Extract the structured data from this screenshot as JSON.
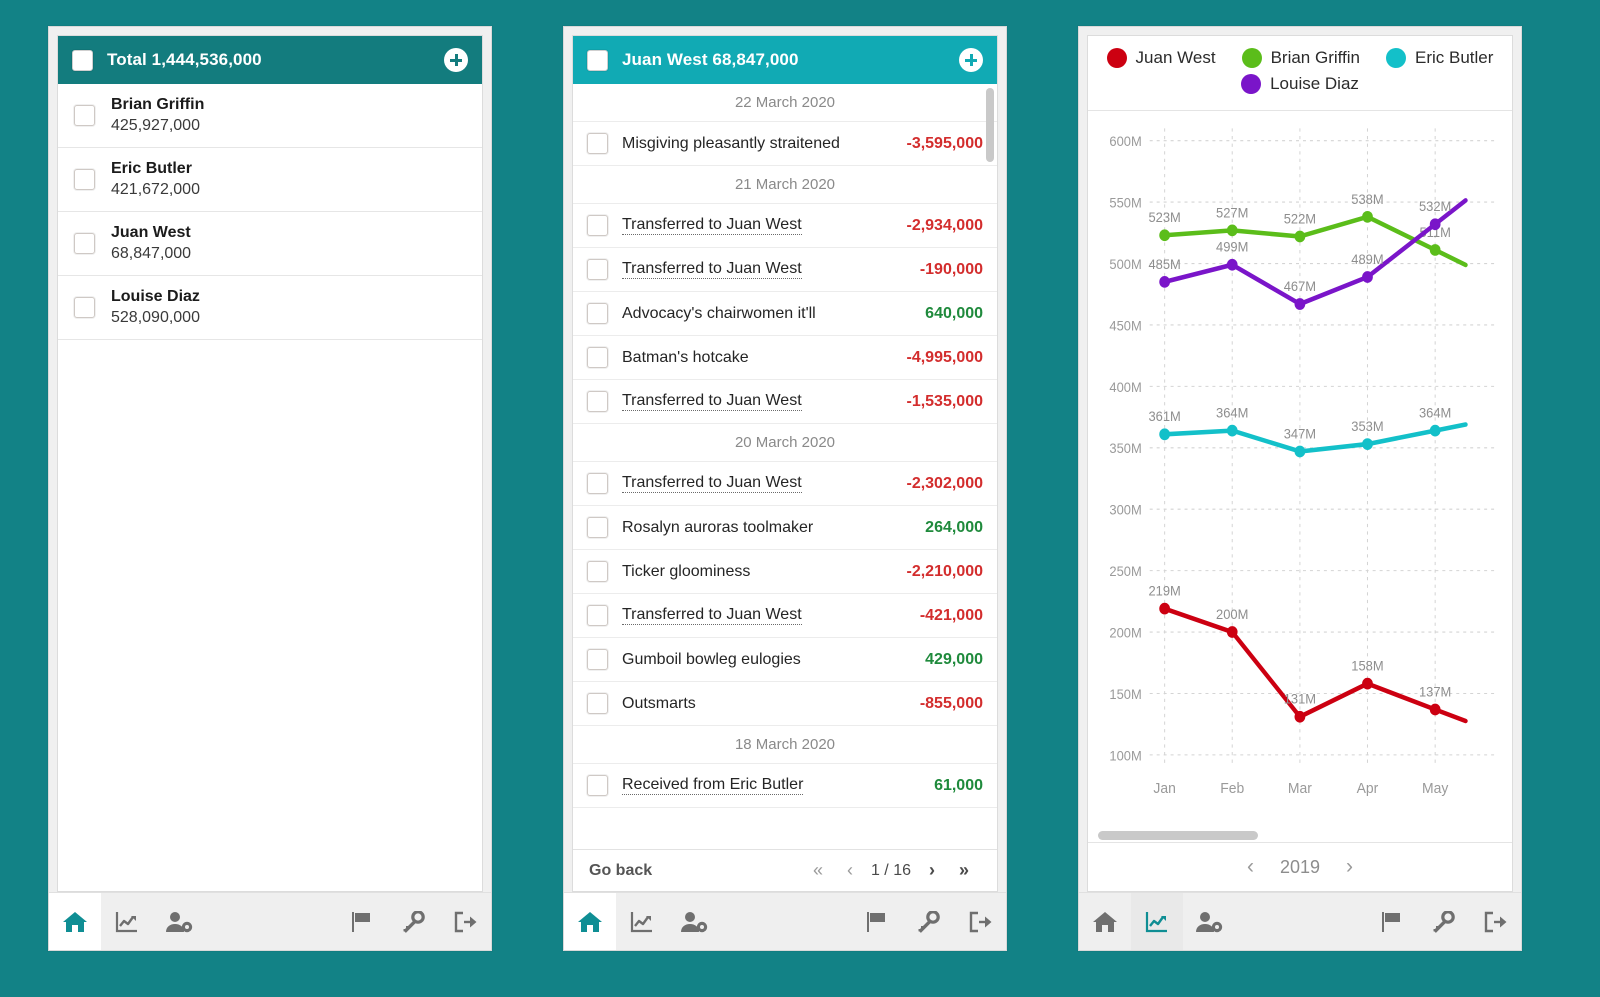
{
  "theme": {
    "background": "#128286",
    "header_dark": "#137c7e",
    "header_light": "#11aab4",
    "negative": "#d32d2d",
    "positive": "#1f8a3c",
    "active_icon": "#0f8e94"
  },
  "accounts_panel": {
    "header": {
      "title": "Total 1,444,536,000",
      "add_icon": "plus-circle-icon",
      "checkbox": "select-all-checkbox"
    },
    "rows": [
      {
        "name": "Brian Griffin",
        "amount": "425,927,000"
      },
      {
        "name": "Eric Butler",
        "amount": "421,672,000"
      },
      {
        "name": "Juan West",
        "amount": "68,847,000"
      },
      {
        "name": "Louise Diaz",
        "amount": "528,090,000"
      }
    ],
    "nav": {
      "left": [
        {
          "icon": "home-icon",
          "active": true
        },
        {
          "icon": "chart-line-icon",
          "active": false
        },
        {
          "icon": "user-settings-icon",
          "active": false
        }
      ],
      "right": [
        {
          "icon": "flag-icon"
        },
        {
          "icon": "key-icon"
        },
        {
          "icon": "logout-icon"
        }
      ]
    }
  },
  "transactions_panel": {
    "header": {
      "title": "Juan West 68,847,000",
      "add_icon": "plus-circle-icon",
      "checkbox": "select-all-checkbox"
    },
    "items": [
      {
        "type": "date",
        "label": "22 March 2020"
      },
      {
        "type": "txn",
        "label": "Misgiving pleasantly straitened",
        "link": false,
        "amount": "-3,595,000",
        "sign": "neg"
      },
      {
        "type": "date",
        "label": "21 March 2020"
      },
      {
        "type": "txn",
        "label": "Transferred to Juan West",
        "link": true,
        "amount": "-2,934,000",
        "sign": "neg"
      },
      {
        "type": "txn",
        "label": "Transferred to Juan West",
        "link": true,
        "amount": "-190,000",
        "sign": "neg"
      },
      {
        "type": "txn",
        "label": "Advocacy's chairwomen it'll",
        "link": false,
        "amount": "640,000",
        "sign": "pos"
      },
      {
        "type": "txn",
        "label": "Batman's hotcake",
        "link": false,
        "amount": "-4,995,000",
        "sign": "neg"
      },
      {
        "type": "txn",
        "label": "Transferred to Juan West",
        "link": true,
        "amount": "-1,535,000",
        "sign": "neg"
      },
      {
        "type": "date",
        "label": "20 March 2020"
      },
      {
        "type": "txn",
        "label": "Transferred to Juan West",
        "link": true,
        "amount": "-2,302,000",
        "sign": "neg"
      },
      {
        "type": "txn",
        "label": "Rosalyn auroras toolmaker",
        "link": false,
        "amount": "264,000",
        "sign": "pos"
      },
      {
        "type": "txn",
        "label": "Ticker gloominess",
        "link": false,
        "amount": "-2,210,000",
        "sign": "neg"
      },
      {
        "type": "txn",
        "label": "Transferred to Juan West",
        "link": true,
        "amount": "-421,000",
        "sign": "neg"
      },
      {
        "type": "txn",
        "label": "Gumboil bowleg eulogies",
        "link": false,
        "amount": "429,000",
        "sign": "pos"
      },
      {
        "type": "txn",
        "label": "Outsmarts",
        "link": false,
        "amount": "-855,000",
        "sign": "neg"
      },
      {
        "type": "date",
        "label": "18 March 2020"
      },
      {
        "type": "txn",
        "label": "Received from Eric Butler",
        "link": true,
        "amount": "61,000",
        "sign": "pos"
      }
    ],
    "pager": {
      "go_back": "Go back",
      "first": "«",
      "prev": "‹",
      "page": "1 / 16",
      "next": "›",
      "last": "»"
    },
    "nav": {
      "left": [
        {
          "icon": "home-icon",
          "active": true
        },
        {
          "icon": "chart-line-icon",
          "active": false
        },
        {
          "icon": "user-settings-icon",
          "active": false
        }
      ],
      "right": [
        {
          "icon": "flag-icon"
        },
        {
          "icon": "key-icon"
        },
        {
          "icon": "logout-icon"
        }
      ]
    }
  },
  "chart_panel": {
    "legend_row1": [
      {
        "label": "Juan West",
        "color": "#cc0011"
      },
      {
        "label": "Brian Griffin",
        "color": "#5bbd1a"
      },
      {
        "label": "Eric Butler",
        "color": "#13c0c9"
      }
    ],
    "legend_row2": [
      {
        "label": "Louise Diaz",
        "color": "#7a15c9"
      }
    ],
    "year_nav": {
      "prev": "‹",
      "year": "2019",
      "next": "›"
    },
    "nav": {
      "left": [
        {
          "icon": "home-icon",
          "active": false
        },
        {
          "icon": "chart-line-icon",
          "active": true
        },
        {
          "icon": "user-settings-icon",
          "active": false
        }
      ],
      "right": [
        {
          "icon": "flag-icon"
        },
        {
          "icon": "key-icon"
        },
        {
          "icon": "logout-icon"
        }
      ]
    }
  },
  "chart_data": {
    "type": "line",
    "title": "",
    "xlabel": "",
    "ylabel": "",
    "categories": [
      "Jan",
      "Feb",
      "Mar",
      "Apr",
      "May"
    ],
    "yticks": [
      "100M",
      "150M",
      "200M",
      "250M",
      "300M",
      "350M",
      "400M",
      "450M",
      "500M",
      "550M",
      "600M"
    ],
    "ylim": [
      90,
      610
    ],
    "grid": true,
    "legend_position": "top",
    "value_labels": true,
    "unit": "M",
    "series": [
      {
        "name": "Juan West",
        "color": "#cc0011",
        "values": [
          219,
          200,
          131,
          158,
          137
        ],
        "labels": [
          "219M",
          "200M",
          "131M",
          "158M",
          "137M"
        ]
      },
      {
        "name": "Brian Griffin",
        "color": "#5bbd1a",
        "values": [
          523,
          527,
          522,
          538,
          511
        ],
        "labels": [
          "523M",
          "527M",
          "522M",
          "538M",
          "511M"
        ]
      },
      {
        "name": "Eric Butler",
        "color": "#13c0c9",
        "values": [
          361,
          364,
          347,
          353,
          364
        ],
        "labels": [
          "361M",
          "364M",
          "347M",
          "353M",
          "364M"
        ]
      },
      {
        "name": "Louise Diaz",
        "color": "#7a15c9",
        "values": [
          485,
          499,
          467,
          489,
          532
        ],
        "labels": [
          "485M",
          "499M",
          "467M",
          "489M",
          "532M"
        ]
      }
    ]
  }
}
